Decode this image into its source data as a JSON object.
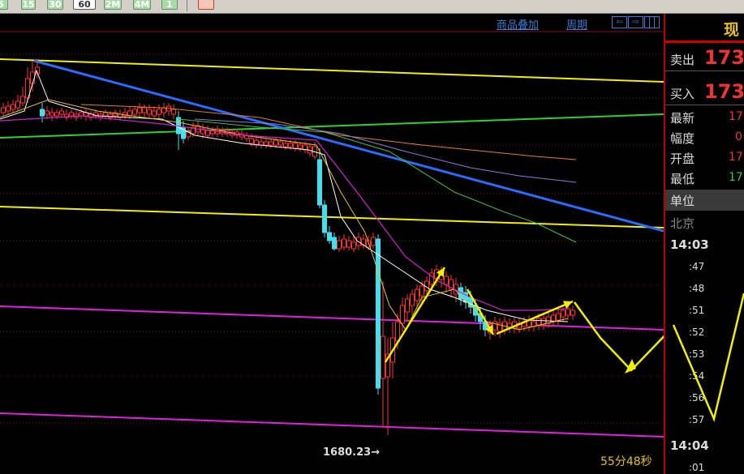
{
  "toolbar": {
    "buttons": [
      "5",
      "15",
      "30",
      "60",
      "2M",
      "4M",
      "1"
    ],
    "active": "60"
  },
  "chart_header": {
    "overlay_link": "商品叠加",
    "period_link": "周期"
  },
  "chart": {
    "low_label": "1680.23→",
    "countdown": "55分48秒"
  },
  "quote_panel": {
    "title": "现",
    "sell_label": "卖出",
    "sell_price": "173",
    "buy_label": "买入",
    "buy_price": "173",
    "rows": [
      {
        "label": "最新",
        "value": "17",
        "color": "#e33"
      },
      {
        "label": "幅度",
        "value": "0",
        "color": "#e33"
      },
      {
        "label": "开盘",
        "value": "17",
        "color": "#e33"
      },
      {
        "label": "最低",
        "value": "17",
        "color": "#3c3"
      }
    ],
    "unit_label": "单位",
    "region": "北京",
    "times": [
      "14:03",
      ":47",
      ":48",
      ":51",
      ":52",
      ":53",
      ":54",
      ":56",
      ":57",
      "14:04",
      ":01"
    ]
  },
  "colors": {
    "up_candle": "#ff3030",
    "down_candle": "#40e0f0",
    "trend_blue": "#2a6cff",
    "channel_yellow": "#f0f000",
    "channel_magenta": "#e020e0",
    "channel_green": "#30d030"
  }
}
